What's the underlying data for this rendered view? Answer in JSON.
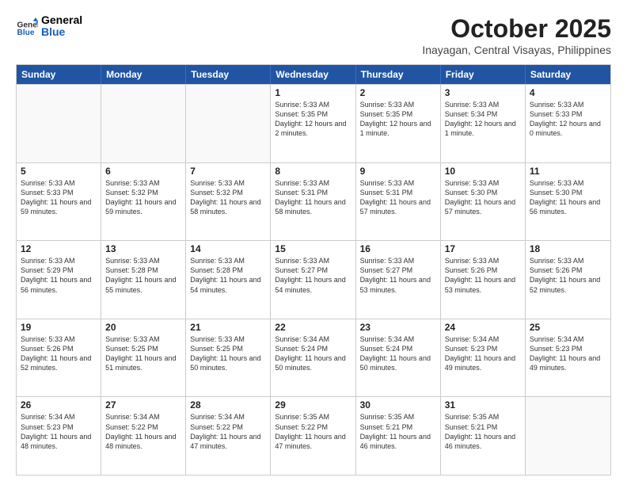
{
  "header": {
    "logo_general": "General",
    "logo_blue": "Blue",
    "month": "October 2025",
    "location": "Inayagan, Central Visayas, Philippines"
  },
  "days_of_week": [
    "Sunday",
    "Monday",
    "Tuesday",
    "Wednesday",
    "Thursday",
    "Friday",
    "Saturday"
  ],
  "weeks": [
    [
      {
        "day": "",
        "sunrise": "",
        "sunset": "",
        "daylight": "",
        "empty": true
      },
      {
        "day": "",
        "sunrise": "",
        "sunset": "",
        "daylight": "",
        "empty": true
      },
      {
        "day": "",
        "sunrise": "",
        "sunset": "",
        "daylight": "",
        "empty": true
      },
      {
        "day": "1",
        "sunrise": "Sunrise: 5:33 AM",
        "sunset": "Sunset: 5:35 PM",
        "daylight": "Daylight: 12 hours and 2 minutes."
      },
      {
        "day": "2",
        "sunrise": "Sunrise: 5:33 AM",
        "sunset": "Sunset: 5:35 PM",
        "daylight": "Daylight: 12 hours and 1 minute."
      },
      {
        "day": "3",
        "sunrise": "Sunrise: 5:33 AM",
        "sunset": "Sunset: 5:34 PM",
        "daylight": "Daylight: 12 hours and 1 minute."
      },
      {
        "day": "4",
        "sunrise": "Sunrise: 5:33 AM",
        "sunset": "Sunset: 5:33 PM",
        "daylight": "Daylight: 12 hours and 0 minutes."
      }
    ],
    [
      {
        "day": "5",
        "sunrise": "Sunrise: 5:33 AM",
        "sunset": "Sunset: 5:33 PM",
        "daylight": "Daylight: 11 hours and 59 minutes."
      },
      {
        "day": "6",
        "sunrise": "Sunrise: 5:33 AM",
        "sunset": "Sunset: 5:32 PM",
        "daylight": "Daylight: 11 hours and 59 minutes."
      },
      {
        "day": "7",
        "sunrise": "Sunrise: 5:33 AM",
        "sunset": "Sunset: 5:32 PM",
        "daylight": "Daylight: 11 hours and 58 minutes."
      },
      {
        "day": "8",
        "sunrise": "Sunrise: 5:33 AM",
        "sunset": "Sunset: 5:31 PM",
        "daylight": "Daylight: 11 hours and 58 minutes."
      },
      {
        "day": "9",
        "sunrise": "Sunrise: 5:33 AM",
        "sunset": "Sunset: 5:31 PM",
        "daylight": "Daylight: 11 hours and 57 minutes."
      },
      {
        "day": "10",
        "sunrise": "Sunrise: 5:33 AM",
        "sunset": "Sunset: 5:30 PM",
        "daylight": "Daylight: 11 hours and 57 minutes."
      },
      {
        "day": "11",
        "sunrise": "Sunrise: 5:33 AM",
        "sunset": "Sunset: 5:30 PM",
        "daylight": "Daylight: 11 hours and 56 minutes."
      }
    ],
    [
      {
        "day": "12",
        "sunrise": "Sunrise: 5:33 AM",
        "sunset": "Sunset: 5:29 PM",
        "daylight": "Daylight: 11 hours and 56 minutes."
      },
      {
        "day": "13",
        "sunrise": "Sunrise: 5:33 AM",
        "sunset": "Sunset: 5:28 PM",
        "daylight": "Daylight: 11 hours and 55 minutes."
      },
      {
        "day": "14",
        "sunrise": "Sunrise: 5:33 AM",
        "sunset": "Sunset: 5:28 PM",
        "daylight": "Daylight: 11 hours and 54 minutes."
      },
      {
        "day": "15",
        "sunrise": "Sunrise: 5:33 AM",
        "sunset": "Sunset: 5:27 PM",
        "daylight": "Daylight: 11 hours and 54 minutes."
      },
      {
        "day": "16",
        "sunrise": "Sunrise: 5:33 AM",
        "sunset": "Sunset: 5:27 PM",
        "daylight": "Daylight: 11 hours and 53 minutes."
      },
      {
        "day": "17",
        "sunrise": "Sunrise: 5:33 AM",
        "sunset": "Sunset: 5:26 PM",
        "daylight": "Daylight: 11 hours and 53 minutes."
      },
      {
        "day": "18",
        "sunrise": "Sunrise: 5:33 AM",
        "sunset": "Sunset: 5:26 PM",
        "daylight": "Daylight: 11 hours and 52 minutes."
      }
    ],
    [
      {
        "day": "19",
        "sunrise": "Sunrise: 5:33 AM",
        "sunset": "Sunset: 5:26 PM",
        "daylight": "Daylight: 11 hours and 52 minutes."
      },
      {
        "day": "20",
        "sunrise": "Sunrise: 5:33 AM",
        "sunset": "Sunset: 5:25 PM",
        "daylight": "Daylight: 11 hours and 51 minutes."
      },
      {
        "day": "21",
        "sunrise": "Sunrise: 5:33 AM",
        "sunset": "Sunset: 5:25 PM",
        "daylight": "Daylight: 11 hours and 50 minutes."
      },
      {
        "day": "22",
        "sunrise": "Sunrise: 5:34 AM",
        "sunset": "Sunset: 5:24 PM",
        "daylight": "Daylight: 11 hours and 50 minutes."
      },
      {
        "day": "23",
        "sunrise": "Sunrise: 5:34 AM",
        "sunset": "Sunset: 5:24 PM",
        "daylight": "Daylight: 11 hours and 50 minutes."
      },
      {
        "day": "24",
        "sunrise": "Sunrise: 5:34 AM",
        "sunset": "Sunset: 5:23 PM",
        "daylight": "Daylight: 11 hours and 49 minutes."
      },
      {
        "day": "25",
        "sunrise": "Sunrise: 5:34 AM",
        "sunset": "Sunset: 5:23 PM",
        "daylight": "Daylight: 11 hours and 49 minutes."
      }
    ],
    [
      {
        "day": "26",
        "sunrise": "Sunrise: 5:34 AM",
        "sunset": "Sunset: 5:23 PM",
        "daylight": "Daylight: 11 hours and 48 minutes."
      },
      {
        "day": "27",
        "sunrise": "Sunrise: 5:34 AM",
        "sunset": "Sunset: 5:22 PM",
        "daylight": "Daylight: 11 hours and 48 minutes."
      },
      {
        "day": "28",
        "sunrise": "Sunrise: 5:34 AM",
        "sunset": "Sunset: 5:22 PM",
        "daylight": "Daylight: 11 hours and 47 minutes."
      },
      {
        "day": "29",
        "sunrise": "Sunrise: 5:35 AM",
        "sunset": "Sunset: 5:22 PM",
        "daylight": "Daylight: 11 hours and 47 minutes."
      },
      {
        "day": "30",
        "sunrise": "Sunrise: 5:35 AM",
        "sunset": "Sunset: 5:21 PM",
        "daylight": "Daylight: 11 hours and 46 minutes."
      },
      {
        "day": "31",
        "sunrise": "Sunrise: 5:35 AM",
        "sunset": "Sunset: 5:21 PM",
        "daylight": "Daylight: 11 hours and 46 minutes."
      },
      {
        "day": "",
        "sunrise": "",
        "sunset": "",
        "daylight": "",
        "empty": true
      }
    ]
  ]
}
